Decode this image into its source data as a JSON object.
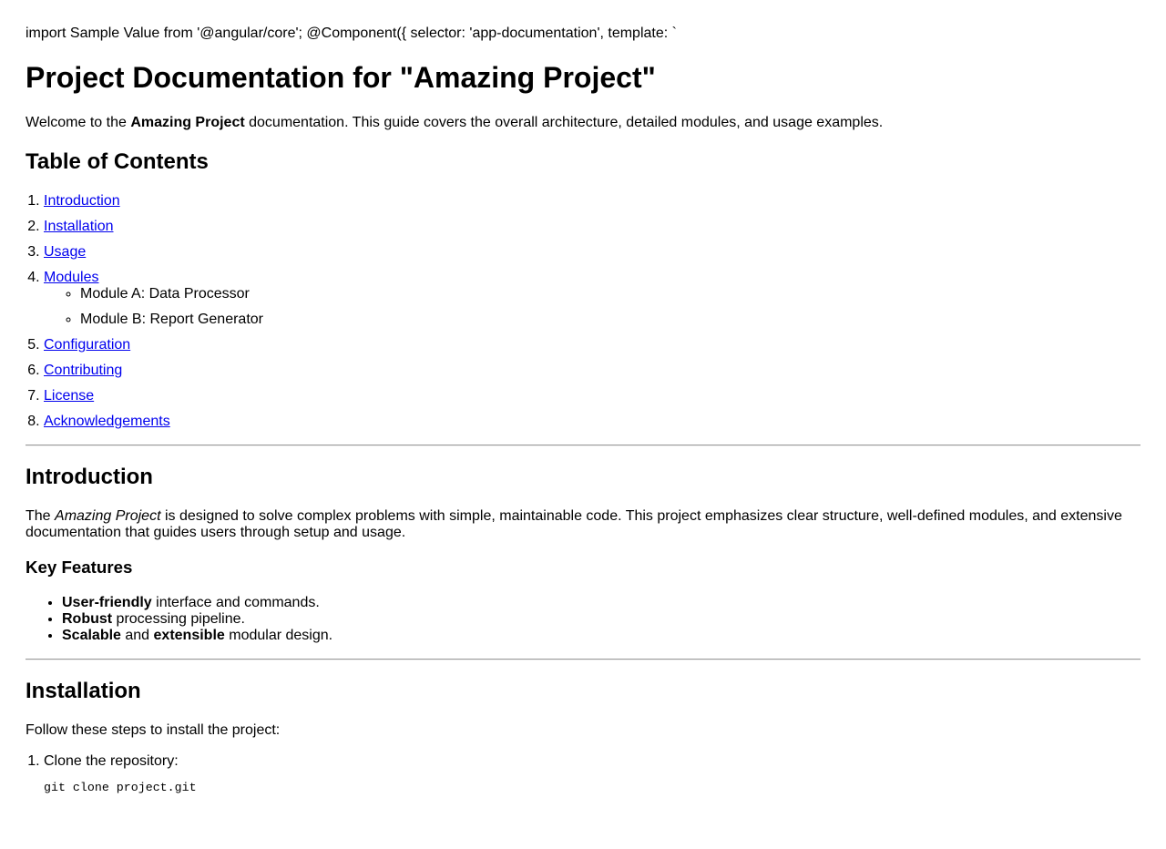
{
  "header": {
    "import_line": "import Sample Value from '@angular/core'; @Component({ selector: 'app-documentation', template: `",
    "title": "Project Documentation for \"Amazing Project\""
  },
  "welcome": {
    "prefix": "Welcome to the ",
    "project_name": "Amazing Project",
    "suffix": " documentation. This guide covers the overall architecture, detailed modules, and usage examples."
  },
  "toc": {
    "heading": "Table of Contents",
    "items": [
      {
        "label": "Introduction"
      },
      {
        "label": "Installation"
      },
      {
        "label": "Usage"
      },
      {
        "label": "Modules"
      },
      {
        "label": "Configuration"
      },
      {
        "label": "Contributing"
      },
      {
        "label": "License"
      },
      {
        "label": "Acknowledgements"
      }
    ],
    "modules_sub": [
      "Module A: Data Processor",
      "Module B: Report Generator"
    ]
  },
  "introduction": {
    "heading": "Introduction",
    "body_prefix": "The ",
    "body_project": "Amazing Project",
    "body_suffix": " is designed to solve complex problems with simple, maintainable code. This project emphasizes clear structure, well-defined modules, and extensive documentation that guides users through setup and usage.",
    "features_heading": "Key Features",
    "features": [
      {
        "bold": "User-friendly",
        "rest": " interface and commands."
      },
      {
        "bold": "Robust",
        "rest": " processing pipeline."
      },
      {
        "bold": "Scalable",
        "mid": " and ",
        "bold2": "extensible",
        "rest": " modular design."
      }
    ]
  },
  "installation": {
    "heading": "Installation",
    "intro": "Follow these steps to install the project:",
    "steps": [
      {
        "label": "Clone the repository:",
        "code": "git clone project.git"
      }
    ]
  }
}
